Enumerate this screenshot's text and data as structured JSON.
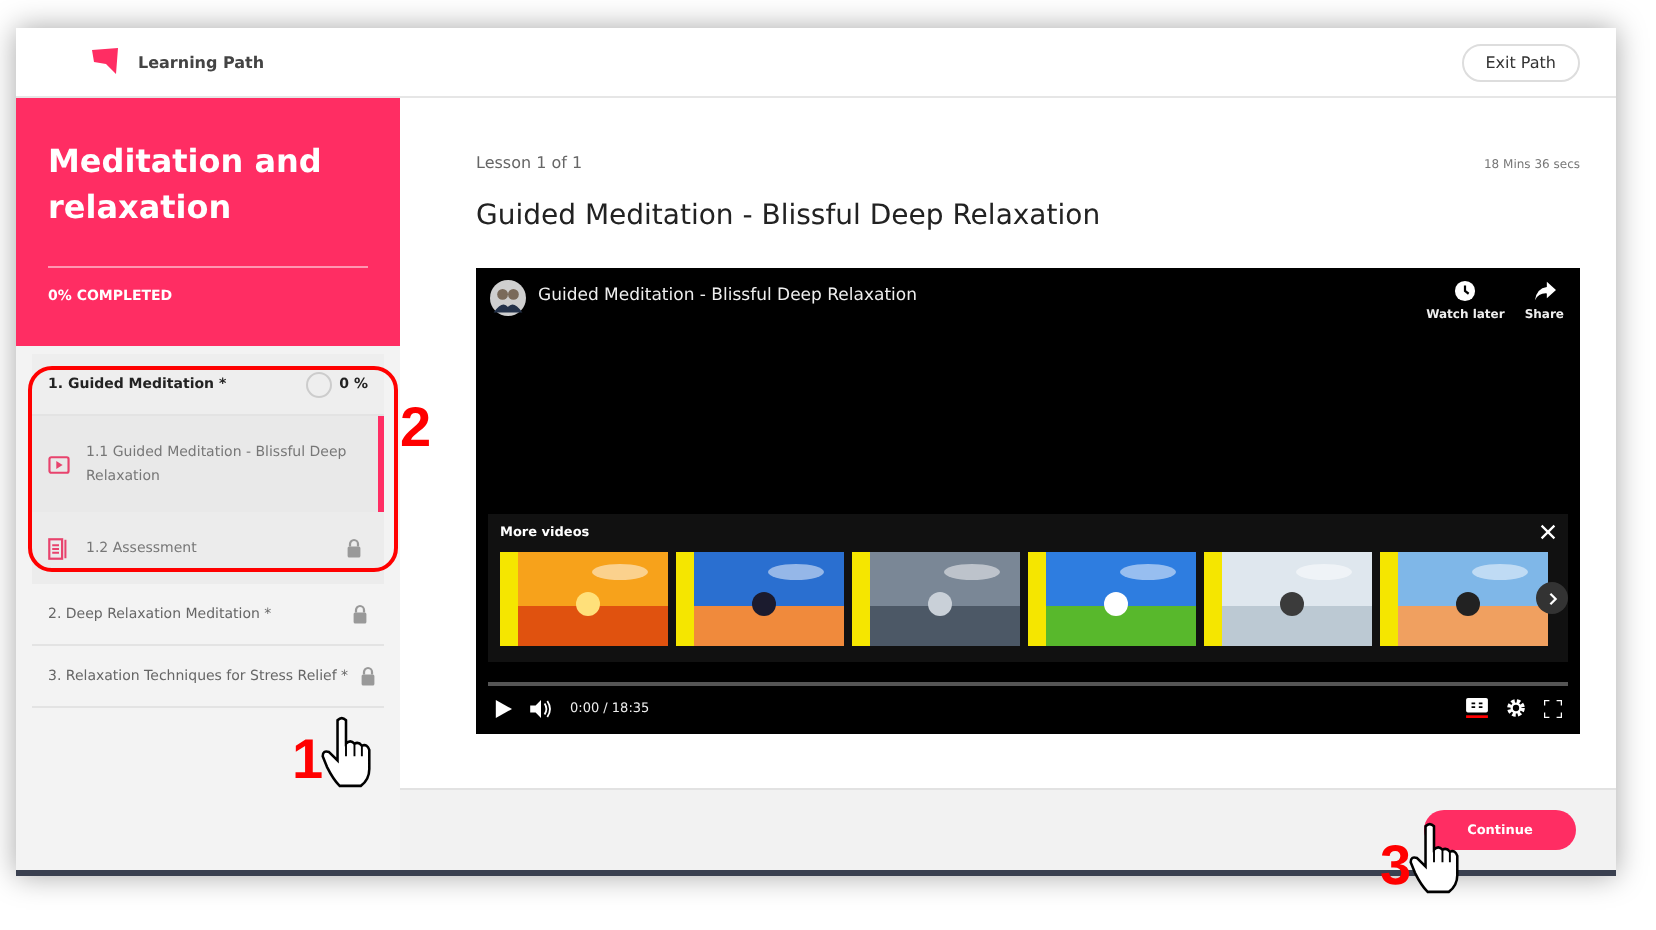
{
  "header": {
    "title": "Learning Path",
    "exit_button": "Exit Path"
  },
  "sidebar": {
    "course_title": "Meditation and relaxation",
    "progress_label": "0% COMPLETED",
    "sections": [
      {
        "title": "1. Guided Meditation *",
        "progress": "0 %",
        "locked": false,
        "expanded": true,
        "children": [
          {
            "title": "1.1 Guided Meditation - Blissful Deep Relaxation",
            "kind": "video",
            "selected": true,
            "locked": false
          },
          {
            "title": "1.2 Assessment",
            "kind": "assessment",
            "selected": false,
            "locked": true
          }
        ]
      },
      {
        "title": "2. Deep Relaxation Meditation *",
        "locked": true,
        "expanded": false
      },
      {
        "title": "3. Relaxation Techniques for Stress Relief *",
        "locked": true,
        "expanded": false
      }
    ]
  },
  "lesson": {
    "counter": "Lesson 1 of 1",
    "duration": "18 Mins 36 secs",
    "title": "Guided Meditation - Blissful Deep Relaxation"
  },
  "video": {
    "title": "Guided Meditation - Blissful Deep Relaxation",
    "actions": [
      {
        "kind": "watch_later",
        "label": "Watch later"
      },
      {
        "kind": "share",
        "label": "Share"
      }
    ],
    "more_videos": {
      "label": "More videos"
    },
    "time": "0:00 / 18:35",
    "level": 0,
    "captions_on": true
  },
  "continue_button": "Continue",
  "annotations": [
    {
      "label": "2",
      "pointer": false
    },
    {
      "label": "1",
      "pointer": true
    },
    {
      "label": "3",
      "pointer": true
    }
  ]
}
